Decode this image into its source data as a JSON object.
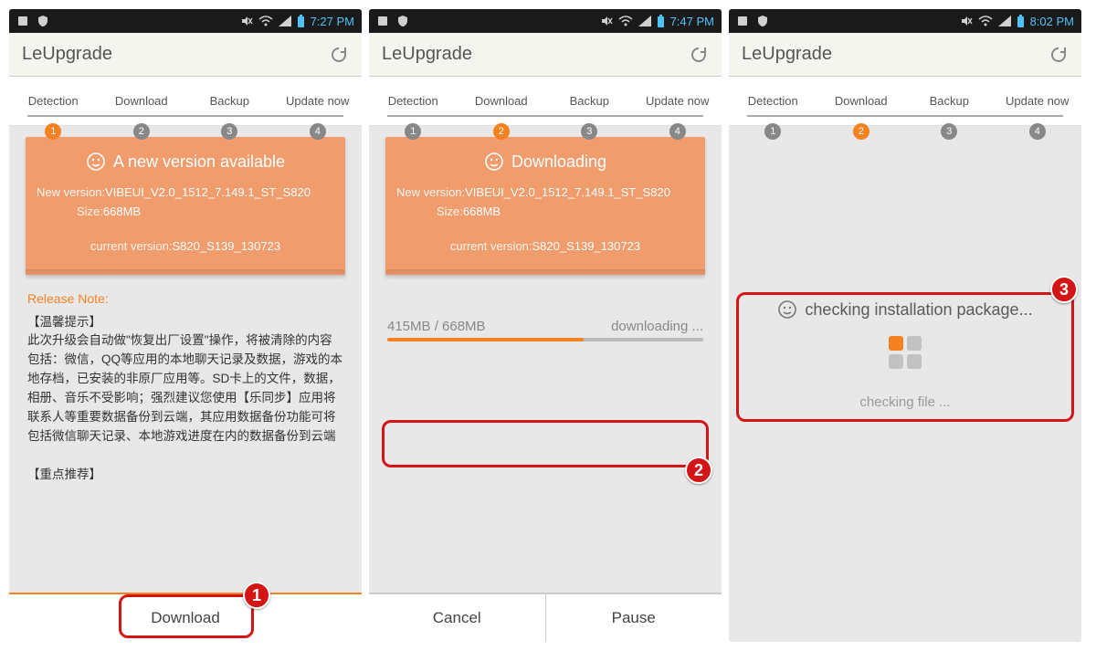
{
  "statusbar": {
    "time1": "7:27 PM",
    "time2": "7:47 PM",
    "time3": "8:02 PM"
  },
  "app": {
    "title": "LeUpgrade"
  },
  "steps": [
    "Detection",
    "Download",
    "Backup",
    "Update now"
  ],
  "screen1": {
    "card_title": "A new version available",
    "new_label": "New version:",
    "new_value": "VIBEUI_V2.0_1512_7.149.1_ST_S820",
    "size_label": "Size:",
    "size_value": "668MB",
    "curr_label": "current version:",
    "curr_value": "S820_S139_130723",
    "release_heading": "Release Note:",
    "release_text": "【温馨提示】\n此次升级会自动做\"恢复出厂设置\"操作，将被清除的内容包括：微信，QQ等应用的本地聊天记录及数据，游戏的本地存档，已安装的非原厂应用等。SD卡上的文件，数据，相册、音乐不受影响；强烈建议您使用【乐同步】应用将联系人等重要数据备份到云端，其应用数据备份功能可将包括微信聊天记录、本地游戏进度在内的数据备份到云端\n\n【重点推荐】",
    "download_btn": "Download"
  },
  "screen2": {
    "card_title": "Downloading",
    "progress": "415MB / 668MB",
    "progress_pct": 62,
    "status": "downloading ...",
    "cancel": "Cancel",
    "pause": "Pause"
  },
  "screen3": {
    "title": "checking installation package...",
    "sub": "checking file ..."
  },
  "badges": {
    "b1": "1",
    "b2": "2",
    "b3": "3"
  }
}
